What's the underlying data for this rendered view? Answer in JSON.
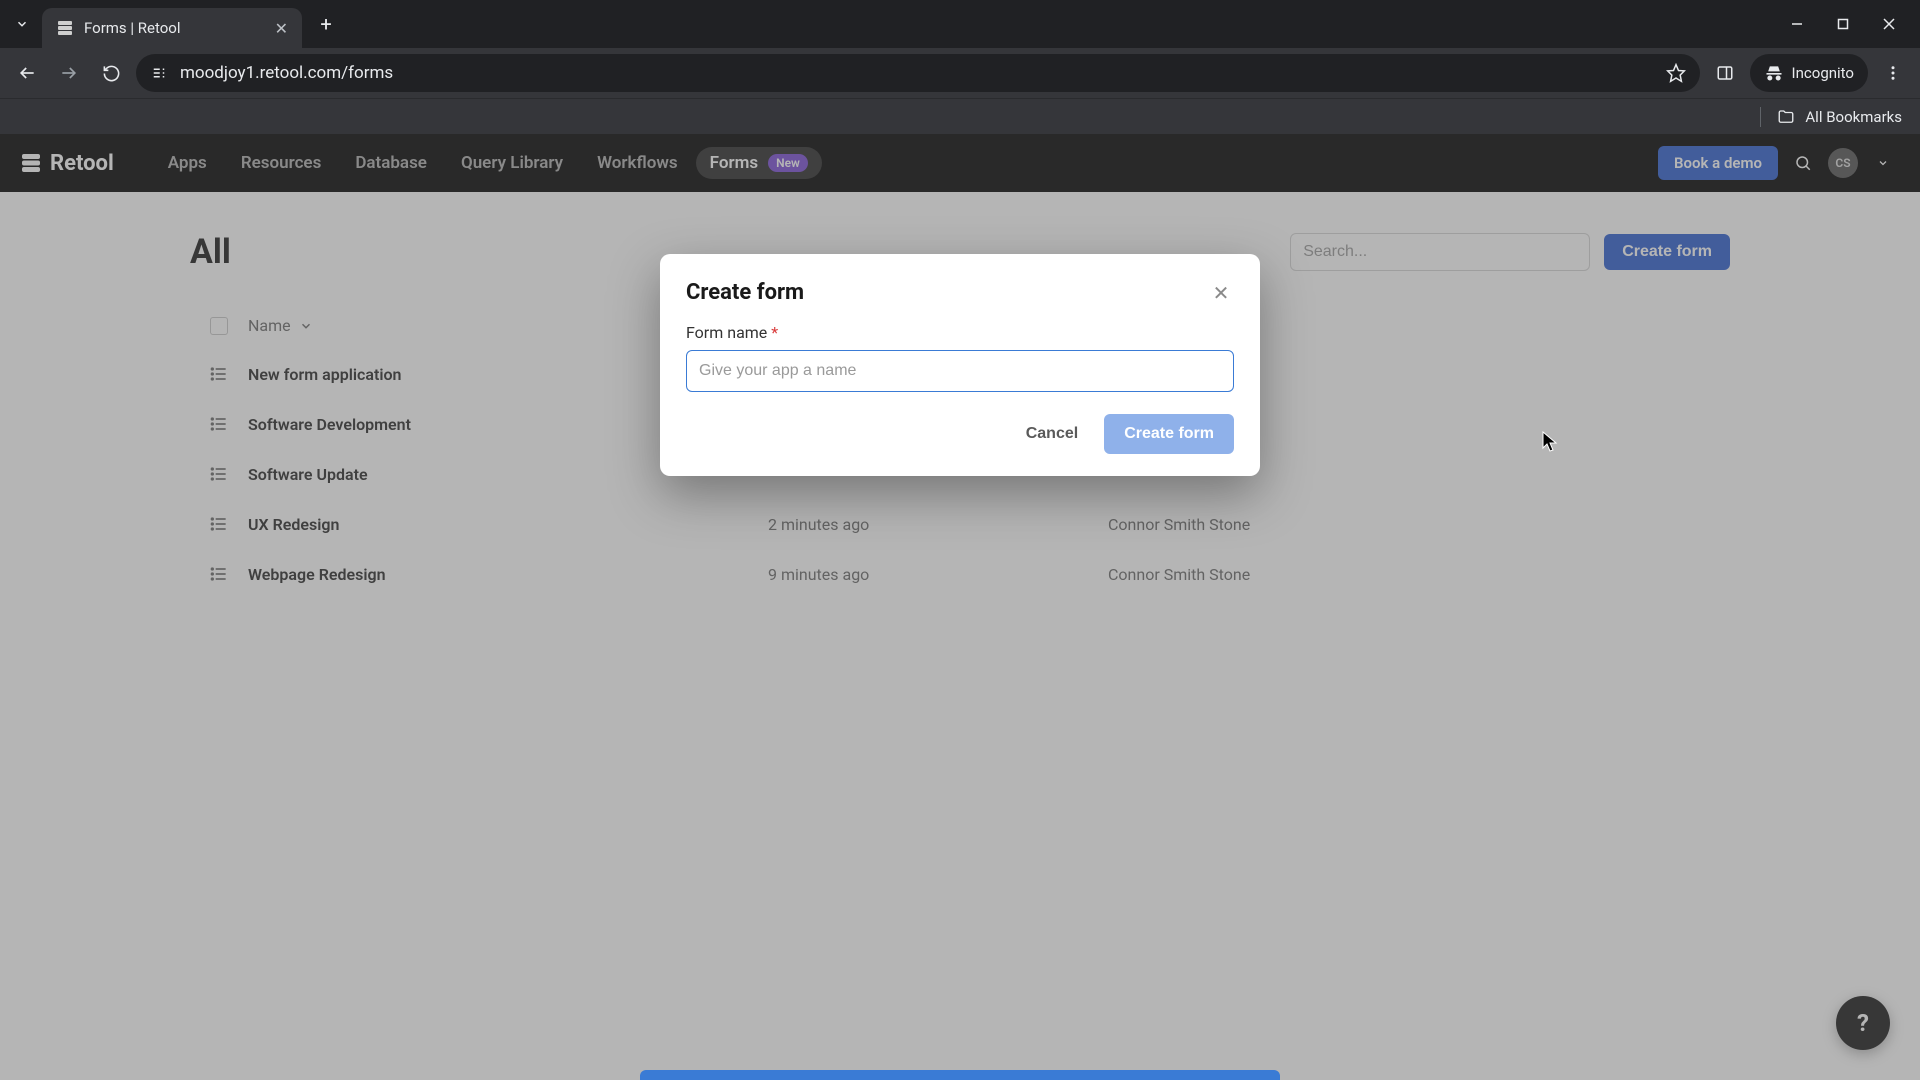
{
  "browser": {
    "tab_title": "Forms | Retool",
    "url": "moodjoy1.retool.com/forms",
    "incognito_label": "Incognito",
    "all_bookmarks": "All Bookmarks"
  },
  "header": {
    "brand": "Retool",
    "nav": {
      "apps": "Apps",
      "resources": "Resources",
      "database": "Database",
      "query_library": "Query Library",
      "workflows": "Workflows",
      "forms": "Forms",
      "new_badge": "New"
    },
    "demo_button": "Book a demo",
    "avatar_initials": "CS"
  },
  "page": {
    "title": "All",
    "search_placeholder": "Search...",
    "create_button": "Create form",
    "columns": {
      "name": "Name"
    },
    "rows": [
      {
        "name": "New form application",
        "time": "",
        "owner": ""
      },
      {
        "name": "Software Development",
        "time": "",
        "owner": ""
      },
      {
        "name": "Software Update",
        "time": "",
        "owner": ""
      },
      {
        "name": "UX Redesign",
        "time": "2 minutes ago",
        "owner": "Connor Smith Stone"
      },
      {
        "name": "Webpage Redesign",
        "time": "9 minutes ago",
        "owner": "Connor Smith Stone"
      }
    ]
  },
  "modal": {
    "title": "Create form",
    "field_label": "Form name",
    "required_mark": "*",
    "placeholder": "Give your app a name",
    "cancel": "Cancel",
    "submit": "Create form"
  },
  "fab": {
    "glyph": "?"
  }
}
